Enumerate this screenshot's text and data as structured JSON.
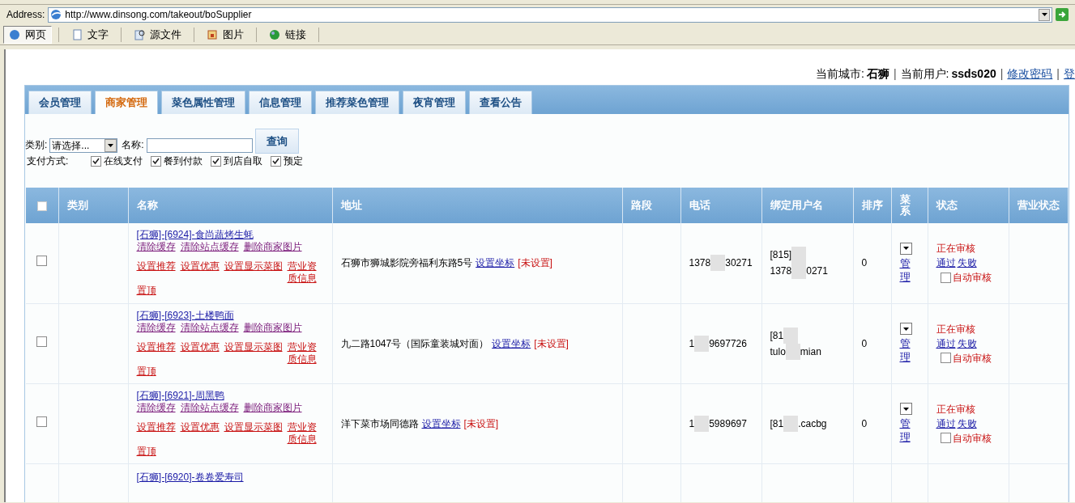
{
  "browser": {
    "address_label": "Address:",
    "url": "http://www.dinsong.com/takeout/boSupplier",
    "view_tabs": [
      {
        "label": "网页",
        "selected": true
      },
      {
        "label": "文字",
        "selected": false
      },
      {
        "label": "源文件",
        "selected": false
      },
      {
        "label": "图片",
        "selected": false
      },
      {
        "label": "链接",
        "selected": false
      }
    ]
  },
  "header": [
    {
      "kind": "label",
      "text": "当前城市:"
    },
    {
      "kind": "value",
      "text": "石狮"
    },
    {
      "kind": "sep",
      "text": "|"
    },
    {
      "kind": "label",
      "text": "当前用户:"
    },
    {
      "kind": "value",
      "text": "ssds020"
    },
    {
      "kind": "sep",
      "text": "|"
    },
    {
      "kind": "link",
      "text": "修改密码"
    },
    {
      "kind": "sep",
      "text": "|"
    },
    {
      "kind": "link",
      "text": "登"
    }
  ],
  "nav_tabs": [
    {
      "label": "会员管理",
      "selected": false
    },
    {
      "label": "商家管理",
      "selected": true
    },
    {
      "label": "菜色属性管理",
      "selected": false
    },
    {
      "label": "信息管理",
      "selected": false
    },
    {
      "label": "推荐菜色管理",
      "selected": false
    },
    {
      "label": "夜宵管理",
      "selected": false
    },
    {
      "label": "查看公告",
      "selected": false
    }
  ],
  "filters": {
    "category_label": "类别:",
    "category_value": "请选择...",
    "name_label": "名称:",
    "query_button": "查询",
    "payment_label": "支付方式:",
    "payment_options": [
      {
        "label": "在线支付",
        "checked": true
      },
      {
        "label": "餐到付款",
        "checked": true
      },
      {
        "label": "到店自取",
        "checked": true
      },
      {
        "label": "预定",
        "checked": true
      }
    ]
  },
  "table": {
    "select_all_checked": false,
    "columns": [
      "类别",
      "名称",
      "地址",
      "路段",
      "电话",
      "绑定用户名",
      "排序",
      "菜系",
      "状态",
      "营业状态"
    ],
    "rows": [
      {
        "checked": false,
        "name": "[石狮]-[6924]-食尚蔬烤生蚝",
        "cache_links": [
          "清除缓存",
          "清除站点缓存",
          "删除商家图片"
        ],
        "action_links": [
          "设置推荐",
          "设置优惠",
          "设置显示菜图",
          "营业资质信息",
          "置顶"
        ],
        "address": [
          {
            "kind": "text",
            "text": "石狮市狮城影院旁福利东路5号"
          },
          {
            "kind": "link",
            "text": "设置坐标"
          },
          {
            "kind": "state",
            "text": "[未设置]"
          }
        ],
        "phone": [
          "1378",
          "30271"
        ],
        "user": [
          [
            "[815]"
          ],
          [
            "1378",
            "0271"
          ]
        ],
        "sort": "0",
        "cuisine_link": "管理",
        "status": "正在审核",
        "approve": "通过",
        "reject": "失败",
        "auto_label": "自动审核",
        "auto_checked": false
      },
      {
        "checked": false,
        "name": "[石狮]-[6923]-土楼鸭面",
        "cache_links": [
          "清除缓存",
          "清除站点缓存",
          "删除商家图片"
        ],
        "action_links": [
          "设置推荐",
          "设置优惠",
          "设置显示菜图",
          "营业资质信息",
          "置顶"
        ],
        "address": [
          {
            "kind": "text",
            "text": "九二路1047号（国际童装城对面）"
          },
          {
            "kind": "link",
            "text": "设置坐标"
          },
          {
            "kind": "state",
            "text": "[未设置]"
          }
        ],
        "phone": [
          "1",
          "9697726"
        ],
        "user": [
          [
            "[81"
          ],
          [
            "tulo",
            "mian"
          ]
        ],
        "sort": "0",
        "cuisine_link": "管理",
        "status": "正在审核",
        "approve": "通过",
        "reject": "失败",
        "auto_label": "自动审核",
        "auto_checked": false
      },
      {
        "checked": false,
        "name": "[石狮]-[6921]-周黑鸭",
        "cache_links": [
          "清除缓存",
          "清除站点缓存",
          "删除商家图片"
        ],
        "action_links": [
          "设置推荐",
          "设置优惠",
          "设置显示菜图",
          "营业资质信息",
          "置顶"
        ],
        "address": [
          {
            "kind": "text",
            "text": "洋下菜市场同德路"
          },
          {
            "kind": "link",
            "text": "设置坐标"
          },
          {
            "kind": "state",
            "text": "[未设置]"
          }
        ],
        "phone": [
          "1",
          "5989697"
        ],
        "user": [
          [
            "[81",
            ".cacbg"
          ]
        ],
        "sort": "0",
        "cuisine_link": "管理",
        "status": "正在审核",
        "approve": "通过",
        "reject": "失败",
        "auto_label": "自动审核",
        "auto_checked": false
      },
      {
        "name": "[石狮]-[6920]-卷卷爱寿司"
      }
    ]
  }
}
